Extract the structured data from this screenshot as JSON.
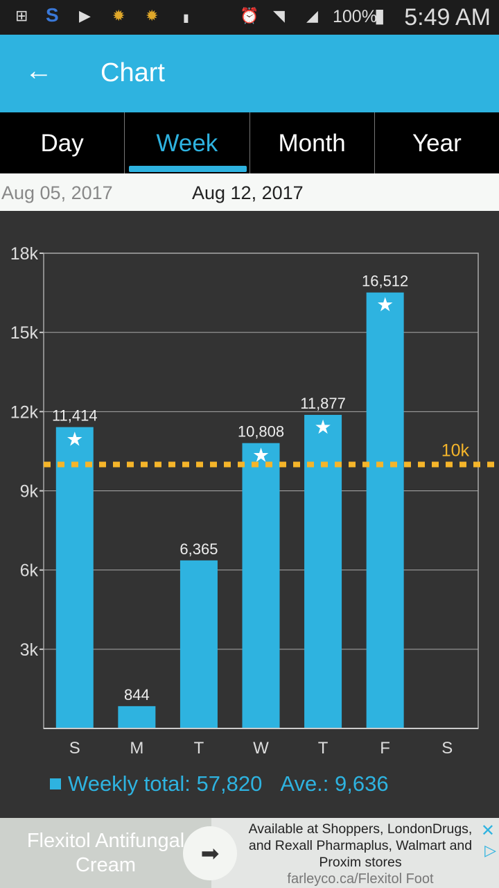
{
  "status_bar": {
    "battery": "100%",
    "time": "5:49 AM",
    "icons": [
      "add-icon",
      "s-health-icon",
      "youtube-icon",
      "weather-icon",
      "weather-icon",
      "battery-100-icon",
      "alarm-icon",
      "wifi-icon",
      "signal-icon",
      "battery-icon"
    ]
  },
  "app_bar": {
    "title": "Chart",
    "back_icon": "arrow-left-icon"
  },
  "tabs": [
    {
      "label": "Day"
    },
    {
      "label": "Week",
      "active": true
    },
    {
      "label": "Month"
    },
    {
      "label": "Year"
    }
  ],
  "dates": {
    "previous": "Aug 05, 2017",
    "current": "Aug 12, 2017"
  },
  "chart_data": {
    "type": "bar",
    "categories": [
      "S",
      "M",
      "T",
      "W",
      "T",
      "F",
      "S"
    ],
    "values": [
      11414,
      844,
      6365,
      10808,
      11877,
      16512,
      null
    ],
    "data_labels": [
      "11,414",
      "844",
      "6,365",
      "10,808",
      "11,877",
      "16,512",
      ""
    ],
    "goal_met": [
      true,
      false,
      false,
      true,
      true,
      true,
      false
    ],
    "ylim": [
      0,
      18000
    ],
    "yticks": [
      3000,
      6000,
      9000,
      12000,
      15000,
      18000
    ],
    "ytick_labels": [
      "3k",
      "6k",
      "9k",
      "12k",
      "15k",
      "18k"
    ],
    "goal_line": {
      "value": 10000,
      "label": "10k",
      "color": "#f5b52a"
    },
    "bar_color": "#2eb3e0",
    "grid": true
  },
  "summary": {
    "weekly_total": "Weekly total: 57,820",
    "average": "Ave.: 9,636"
  },
  "ad": {
    "headline": "Flexitol Antifungal Cream",
    "body": "Available at Shoppers, LondonDrugs, and Rexall Pharmaplus, Walmart and Proxim stores",
    "url": "farleyco.ca/Flexitol Foot",
    "close": "✕",
    "adchoices": "▷"
  }
}
